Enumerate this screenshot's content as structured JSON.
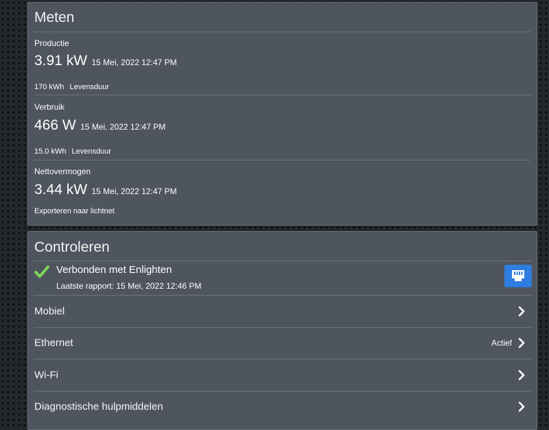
{
  "meten": {
    "title": "Meten",
    "productie": {
      "label": "Productie",
      "value": "3.91 kW",
      "timestamp": "15 Mei, 2022 12:47 PM",
      "lifetime_value": "170 kWh",
      "lifetime_label": "Levensduur"
    },
    "verbruik": {
      "label": "Verbruik",
      "value": "466 W",
      "timestamp": "15 Mei, 2022 12:47 PM",
      "lifetime_value": "15.0 kWh",
      "lifetime_label": "Levensduur"
    },
    "netto": {
      "label": "Nettovermogen",
      "value": "3.44 kW",
      "timestamp": "15 Mei, 2022 12:47 PM",
      "status": "Exporteren naar lichtnet"
    }
  },
  "controleren": {
    "title": "Controleren",
    "connection": {
      "status": "Verbonden met Enlighten",
      "last_report": "Laatste rapport: 15 Mei, 2022 12:46 PM",
      "status_icon": "checkmark-icon",
      "action_icon": "ethernet-icon",
      "check_color": "#7ed957",
      "button_color": "#2f7de0"
    },
    "rows": [
      {
        "label": "Mobiel",
        "status": ""
      },
      {
        "label": "Ethernet",
        "status": "Actief"
      },
      {
        "label": "Wi-Fi",
        "status": ""
      },
      {
        "label": "Diagnostische hulpmiddelen",
        "status": ""
      }
    ]
  }
}
